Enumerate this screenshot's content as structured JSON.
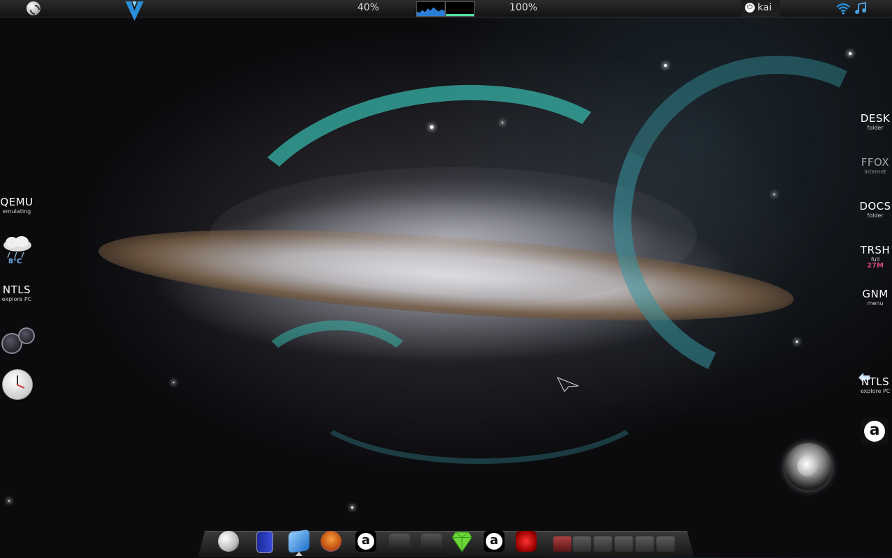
{
  "top_panel": {
    "cpu_percent": "40%",
    "volume_percent": "100%",
    "user": "kai",
    "cpu_graph_color": "#2a7fd4",
    "mem_graph_color": "#4fe0a0"
  },
  "left_widgets": {
    "qemu": {
      "title": "QEMU",
      "subtitle": "emulating"
    },
    "weather": {
      "temperature": "8°C",
      "icon": "rain-cloud-icon"
    },
    "ntls": {
      "title": "NTLS",
      "subtitle": "explore PC"
    }
  },
  "right_launchers": [
    {
      "title": "DESK",
      "subtitle": "folder"
    },
    {
      "title": "FFOX",
      "subtitle": "internet"
    },
    {
      "title": "DOCS",
      "subtitle": "folder"
    },
    {
      "title": "TRSH",
      "subtitle": "full",
      "extra": "27M"
    },
    {
      "title": "GNM",
      "subtitle": "menu"
    },
    {
      "title": "NTLS",
      "subtitle": "explore PC"
    }
  ],
  "dock": {
    "icons": [
      "yin-yang-icon",
      "file-manager-icon",
      "cursor-app-icon",
      "cat-app-icon",
      "amarok-icon",
      "drive-icon",
      "drive-icon",
      "gem-icon",
      "amarok-icon",
      "swirl-app-icon"
    ],
    "workspaces": 6
  },
  "accent_color": "#37b3a8"
}
